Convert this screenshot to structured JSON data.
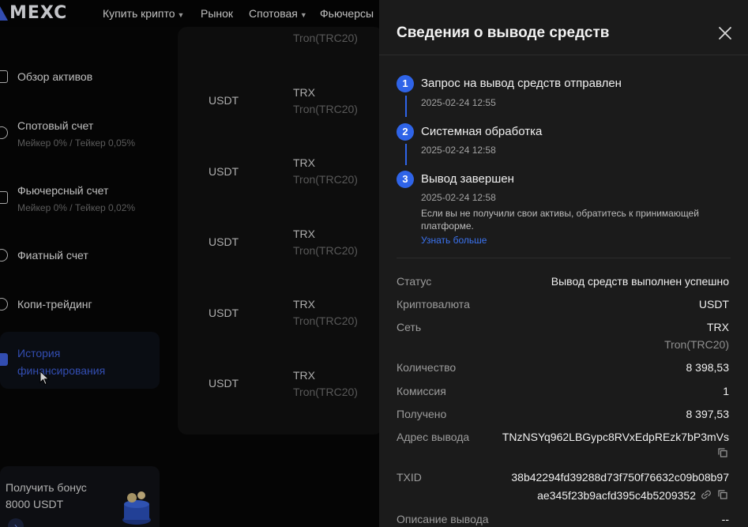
{
  "nav": {
    "logo": "MEXC",
    "items": [
      {
        "label": "Купить крипто",
        "caret": true
      },
      {
        "label": "Рынок",
        "caret": false
      },
      {
        "label": "Спотовая",
        "caret": true
      },
      {
        "label": "Фьючерсы",
        "caret": false
      }
    ]
  },
  "sidebar": {
    "items": [
      {
        "label": "Обзор активов",
        "sub": ""
      },
      {
        "label": "Спотовый счет",
        "sub": "Мейкер 0% / Тейкер 0,05%"
      },
      {
        "label": "Фьючерсный счет",
        "sub": "Мейкер 0% / Тейкер 0,02%"
      },
      {
        "label": "Фиатный счет",
        "sub": ""
      },
      {
        "label": "Копи-трейдинг",
        "sub": ""
      },
      {
        "label": "История финансирования",
        "sub": ""
      }
    ],
    "bonus": {
      "line1": "Получить бонус",
      "line2": "8000 USDT"
    }
  },
  "list": {
    "rows": [
      {
        "coin": "",
        "network": "",
        "network_full": "Tron(TRC20)"
      },
      {
        "coin": "USDT",
        "network": "TRX",
        "network_full": "Tron(TRC20)"
      },
      {
        "coin": "USDT",
        "network": "TRX",
        "network_full": "Tron(TRC20)"
      },
      {
        "coin": "USDT",
        "network": "TRX",
        "network_full": "Tron(TRC20)"
      },
      {
        "coin": "USDT",
        "network": "TRX",
        "network_full": "Tron(TRC20)"
      },
      {
        "coin": "USDT",
        "network": "TRX",
        "network_full": "Tron(TRC20)"
      }
    ]
  },
  "drawer": {
    "title": "Сведения о выводе средств",
    "steps": [
      {
        "num": "1",
        "title": "Запрос на вывод средств отправлен",
        "time": "2025-02-24 12:55"
      },
      {
        "num": "2",
        "title": "Системная обработка",
        "time": "2025-02-24 12:58"
      },
      {
        "num": "3",
        "title": "Вывод завершен",
        "time": "2025-02-24 12:58"
      }
    ],
    "note": "Если вы не получили свои активы, обратитесь к принимающей платформе.",
    "learn_more": "Узнать больше",
    "details": {
      "status_label": "Статус",
      "status_value": "Вывод средств выполнен успешно",
      "crypto_label": "Криптовалюта",
      "crypto_value": "USDT",
      "network_label": "Сеть",
      "network_value": "TRX",
      "network_full": "Tron(TRC20)",
      "amount_label": "Количество",
      "amount_value": "8 398,53",
      "fee_label": "Комиссия",
      "fee_value": "1",
      "received_label": "Получено",
      "received_value": "8 397,53",
      "address_label": "Адрес вывода",
      "address_value": "TNzNSYq962LBGypc8RVxEdpREzk7bP3mVs",
      "txid_label": "TXID",
      "txid_line1": "38b42294fd39288d73f750f76632c09b08b97",
      "txid_line2": "ae345f23b9acfd395c4b5209352",
      "desc_label": "Описание вывода",
      "desc_value": "--"
    }
  },
  "colors": {
    "accent": "#2f64e8",
    "link": "#3b73f0",
    "active_sidebar": "#3e5fd8"
  }
}
